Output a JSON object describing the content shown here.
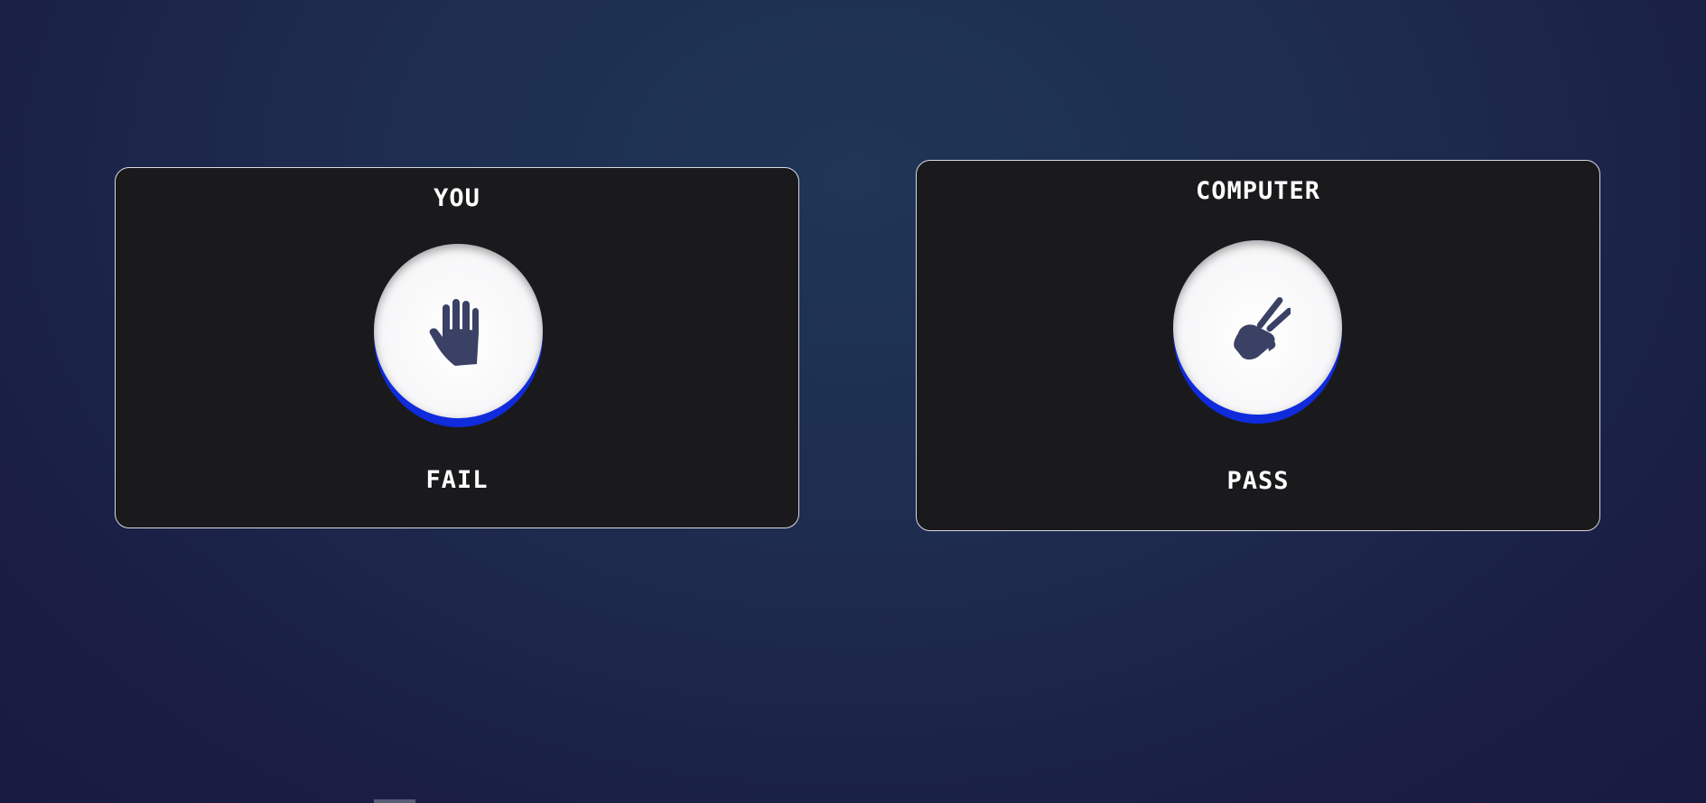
{
  "players": {
    "you": {
      "title": "YOU",
      "choice_icon": "paper-hand-icon",
      "result": "FAIL"
    },
    "computer": {
      "title": "COMPUTER",
      "choice_icon": "scissors-hand-icon",
      "result": "PASS"
    }
  },
  "colors": {
    "panel_bg": "#1a1a1c",
    "panel_border": "#d9d9e0",
    "button_face": "#ffffff",
    "button_edge": "#0f2bdc",
    "icon": "#3a4165",
    "text": "#ffffff"
  }
}
